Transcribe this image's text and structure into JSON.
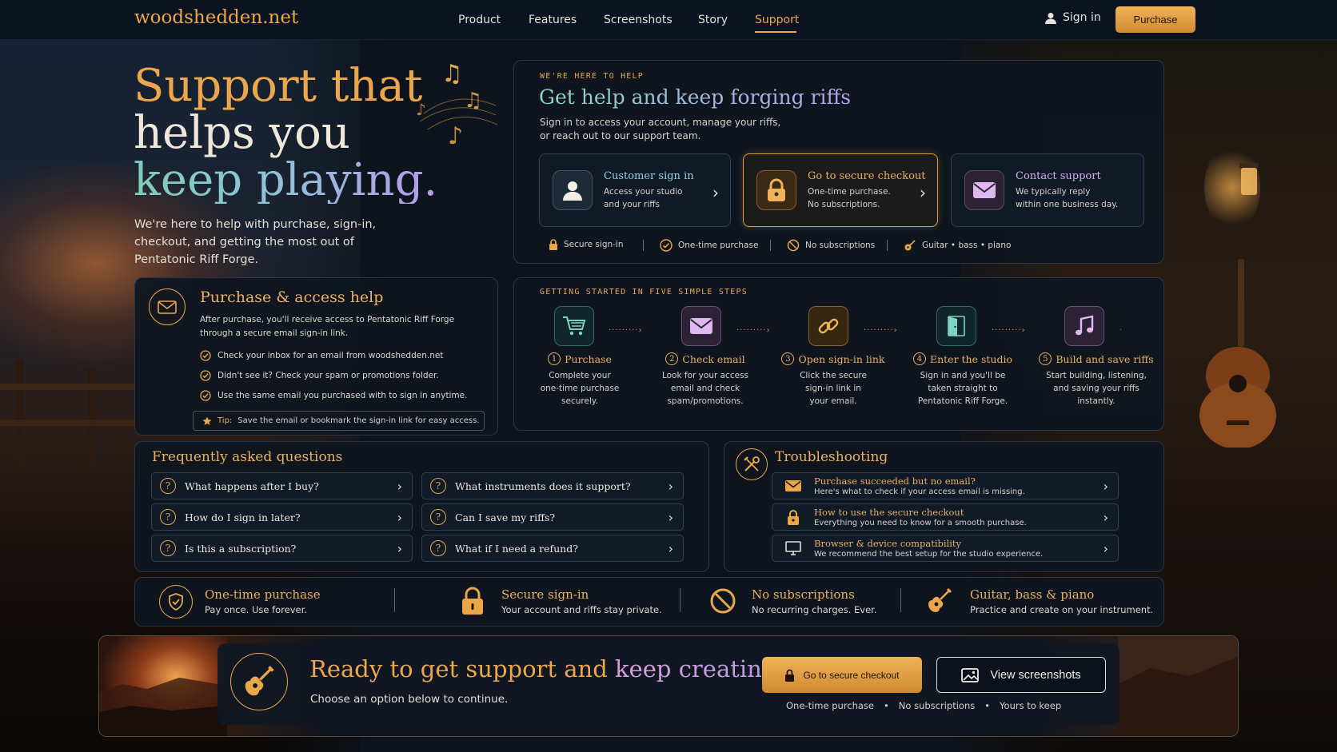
{
  "header": {
    "logo": "woodshedden.net",
    "nav": [
      "Product",
      "Features",
      "Screenshots",
      "Story",
      "Support"
    ],
    "active_nav": "Support",
    "signin_label": "Sign in",
    "purchase_label": "Purchase"
  },
  "hero": {
    "title_line1": "Support that",
    "title_line2": "helps you",
    "title_line3": "keep playing.",
    "subtitle": "We're here to help with purchase, sign-in, checkout, and getting the most out of Pentatonic Riff Forge."
  },
  "help_panel": {
    "eyebrow": "WE'RE HERE TO HELP",
    "title": "Get help and keep forging riffs",
    "subtitle_line1": "Sign in to access your account, manage your riffs,",
    "subtitle_line2": "or reach out to our support team.",
    "cards": [
      {
        "title": "Customer sign in",
        "desc_line1": "Access your studio",
        "desc_line2": "and your riffs",
        "icon": "user-icon"
      },
      {
        "title": "Go to secure checkout",
        "desc_line1": "One-time purchase.",
        "desc_line2": "No subscriptions.",
        "icon": "lock-icon"
      },
      {
        "title": "Contact support",
        "desc_line1": "We typically reply",
        "desc_line2": "within one business day.",
        "icon": "mail-icon"
      }
    ],
    "trust": [
      "Secure sign-in",
      "One-time purchase",
      "No subscriptions",
      "Guitar • bass • piano"
    ]
  },
  "purchase_help": {
    "title": "Purchase & access help",
    "desc_line1": "After purchase, you'll receive access to Pentatonic Riff Forge",
    "desc_line2": "through a secure email sign-in link.",
    "checks": [
      "Check your inbox for an email from woodshedden.net",
      "Didn't see it? Check your spam or promotions folder.",
      "Use the same email you purchased with to sign in anytime."
    ],
    "tip_label": "Tip:",
    "tip_text": "Save the email or bookmark the sign-in link for easy access."
  },
  "steps": {
    "eyebrow": "GETTING STARTED IN FIVE SIMPLE STEPS",
    "items": [
      {
        "num": "1",
        "title": "Purchase",
        "d1": "Complete your",
        "d2": "one-time purchase",
        "d3": "securely.",
        "icon": "cart-icon",
        "color": "#7fd3c4"
      },
      {
        "num": "2",
        "title": "Check email",
        "d1": "Look for your access",
        "d2": "email and check",
        "d3": "spam/promotions.",
        "icon": "mail-icon",
        "color": "#c48ae0"
      },
      {
        "num": "3",
        "title": "Open sign-in link",
        "d1": "Click the secure",
        "d2": "sign-in link in",
        "d3": "your email.",
        "icon": "link-icon",
        "color": "#e9a74a"
      },
      {
        "num": "4",
        "title": "Enter the studio",
        "d1": "Sign in and you'll be",
        "d2": "taken straight to",
        "d3": "Pentatonic Riff Forge.",
        "icon": "door-icon",
        "color": "#7fd3c4"
      },
      {
        "num": "5",
        "title": "Build and save riffs",
        "d1": "Start building, listening,",
        "d2": "and saving your riffs",
        "d3": "instantly.",
        "icon": "music-note-icon",
        "color": "#c48ae0"
      }
    ]
  },
  "faq": {
    "title": "Frequently asked questions",
    "items": [
      "What happens after I buy?",
      "What instruments does it support?",
      "How do I sign in later?",
      "Can I save my riffs?",
      "Is this a subscription?",
      "What if I need a refund?"
    ]
  },
  "troubleshooting": {
    "title": "Troubleshooting",
    "items": [
      {
        "title": "Purchase succeeded but no email?",
        "desc": "Here's what to check if your access email is missing.",
        "icon": "mail-icon"
      },
      {
        "title": "How to use the secure checkout",
        "desc": "Everything you need to know for a smooth purchase.",
        "icon": "lock-icon"
      },
      {
        "title": "Browser & device compatibility",
        "desc": "We recommend the best setup for the studio experience.",
        "icon": "monitor-icon"
      }
    ]
  },
  "features": [
    {
      "title": "One-time purchase",
      "desc": "Pay once. Use forever.",
      "icon": "shield-check-icon"
    },
    {
      "title": "Secure sign-in",
      "desc": "Your account and riffs stay private.",
      "icon": "lock-icon"
    },
    {
      "title": "No subscriptions",
      "desc": "No recurring charges. Ever.",
      "icon": "no-symbol-icon"
    },
    {
      "title": "Guitar, bass & piano",
      "desc": "Practice and create on your instrument.",
      "icon": "guitar-icon"
    }
  ],
  "cta": {
    "title_part1": "Ready to get support and",
    "title_part2": "keep creating?",
    "subtitle": "Choose an option below to continue.",
    "primary_label": "Go to secure checkout",
    "secondary_label": "View screenshots",
    "footnote": [
      "One-time purchase",
      "No subscriptions",
      "Yours to keep"
    ]
  },
  "colors": {
    "accent": "#e9a74a",
    "teal": "#7fd3c4",
    "violet": "#c48ae0",
    "background": "#0b1119"
  }
}
